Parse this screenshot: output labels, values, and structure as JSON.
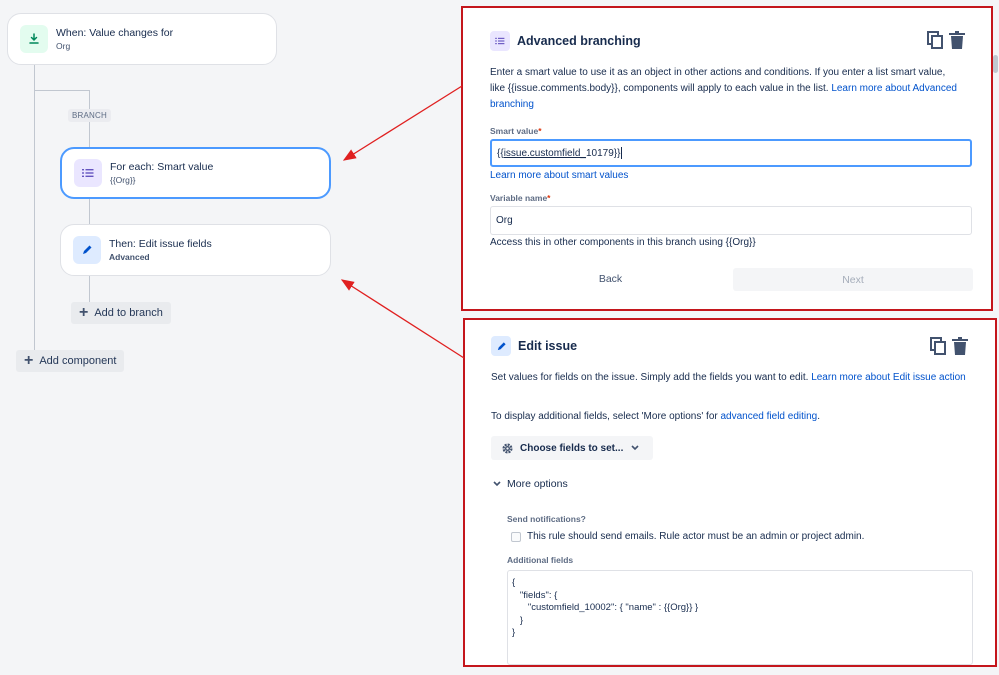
{
  "trigger": {
    "title": "When: Value changes for",
    "subtitle": "Org"
  },
  "branch_tag": "BRANCH",
  "for_each": {
    "title": "For each: Smart value",
    "subtitle": "{{Org}}"
  },
  "then_edit": {
    "title": "Then: Edit issue fields",
    "subtitle": "Advanced"
  },
  "add_to_branch": "Add to branch",
  "add_component": "Add component",
  "advanced_branching": {
    "title": "Advanced branching",
    "description": "Enter a smart value to use it as an object in other actions and conditions. If you enter a list smart value, like {{issue.comments.body}}, components will apply to each value in the list.",
    "description_link": "Learn more about Advanced branching",
    "smart_value_label": "Smart value",
    "smart_value_prefix": "{{",
    "smart_value_underlined": "issue.customfield_",
    "smart_value_suffix": "10179}}",
    "smart_value_link": "Learn more about smart values",
    "variable_name_label": "Variable name",
    "variable_name_value": "Org",
    "variable_help": "Access this in other components in this branch using {{Org}}",
    "back_label": "Back",
    "next_label": "Next"
  },
  "edit_issue": {
    "title": "Edit issue",
    "description": "Set values for fields on the issue. Simply add the fields you want to edit.",
    "description_link": "Learn more about Edit issue action",
    "more_options_text": "To display additional fields, select 'More options' for",
    "more_options_link": "advanced field editing",
    "more_options_end": ".",
    "choose_fields_label": "Choose fields to set...",
    "more_options_toggle": "More options",
    "send_notifications_label": "Send notifications?",
    "send_notifications_checkbox": "This rule should send emails. Rule actor must be an admin or project admin.",
    "additional_fields_label": "Additional fields",
    "additional_fields_value": "{\n   \"fields\": {\n      \"customfield_10002\": { \"name\" : {{Org}} }\n   }\n}"
  },
  "colors": {
    "highlight_border": "#c4161c",
    "arrow": "#e02020",
    "link": "#0052cc",
    "focus": "#4c9aff"
  }
}
